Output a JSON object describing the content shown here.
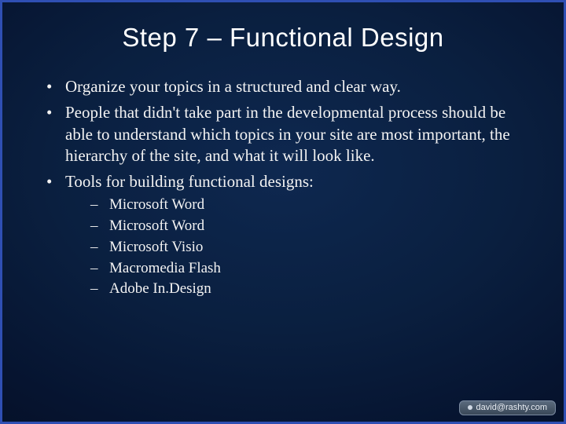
{
  "title": "Step 7 – Functional Design",
  "bullets": {
    "b0": "Organize your topics in a structured and clear way.",
    "b1": "People that didn't take part in the developmental process should be able to understand which topics in your site are most important, the hierarchy of the site, and what it will look like.",
    "b2": "Tools for building functional designs:"
  },
  "sub": {
    "s0": "Microsoft Word",
    "s1": "Microsoft Word",
    "s2": "Microsoft Visio",
    "s3": "Macromedia Flash",
    "s4": "Adobe In.Design"
  },
  "footer": {
    "text": "david@rashty.com"
  }
}
